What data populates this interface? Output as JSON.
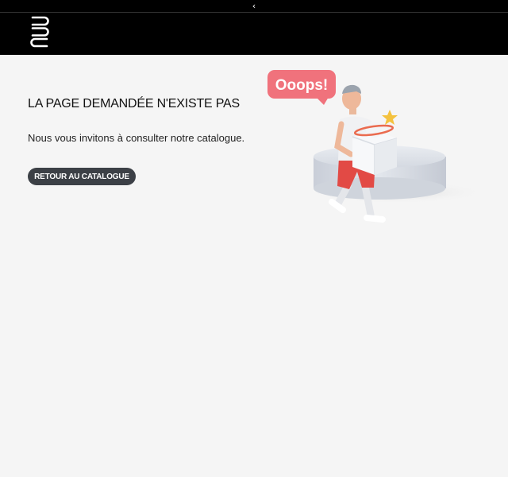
{
  "topbar": {
    "collapse_icon": "chevron-left-icon",
    "collapse_glyph": "‹"
  },
  "header": {
    "logo_icon": "brand-logo"
  },
  "main": {
    "title": "LA PAGE DEMANDÉE N'EXISTE PAS",
    "subtitle": "Nous vous invitons à consulter notre catalogue.",
    "button_label": "RETOUR AU CATALOGUE"
  },
  "illustration": {
    "bubble_text": "Ooops!",
    "bubble_color": "#f0727c",
    "shorts_color": "#e24a45"
  },
  "colors": {
    "header_bg": "#000000",
    "page_bg": "#f5f5f5",
    "button_bg": "#3c4046"
  }
}
